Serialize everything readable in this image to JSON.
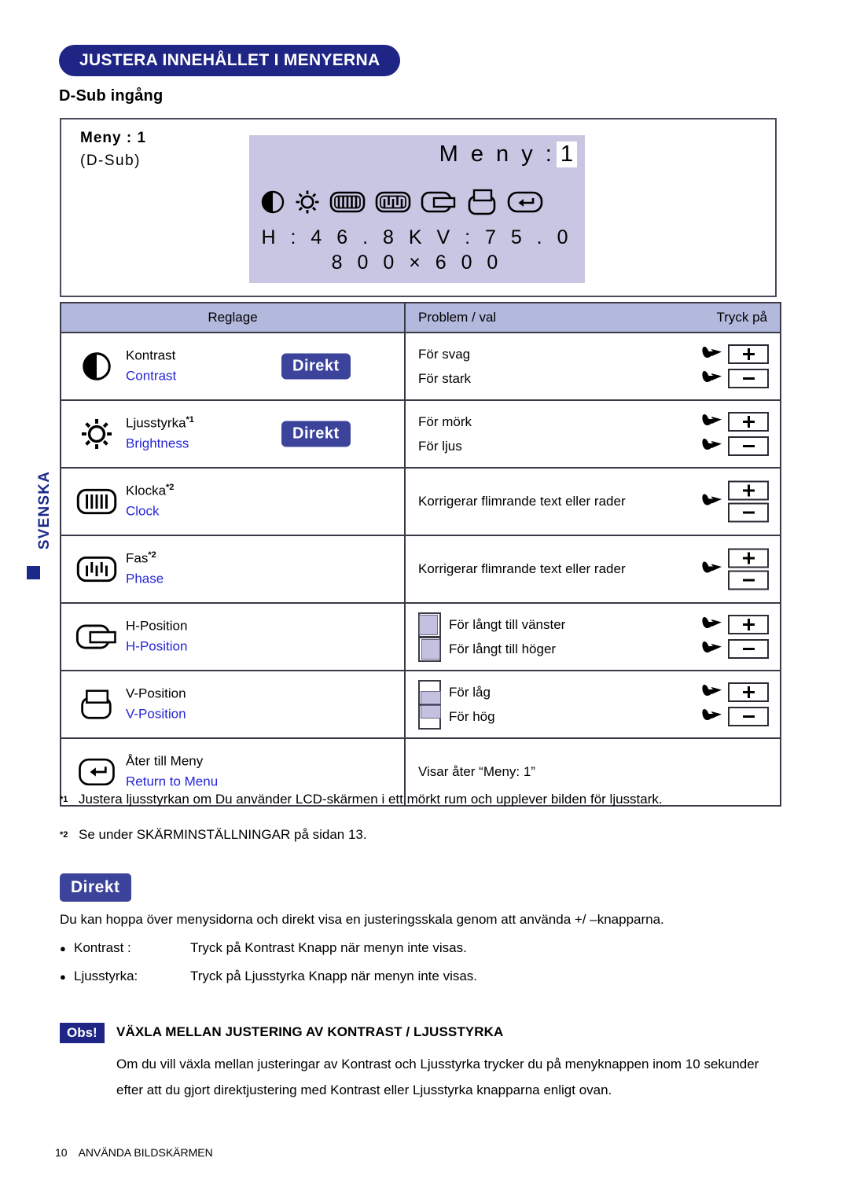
{
  "side_tab": {
    "language": "SVENSKA"
  },
  "header": {
    "title": "JUSTERA INNEHÅLLET I MENYERNA",
    "subtitle": "D-Sub ingång"
  },
  "osd_preview": {
    "left_title": "Meny : 1",
    "left_sub": "(D-Sub)",
    "menu_label": "M e n y :",
    "menu_number": "1",
    "frequency": "H : 4 6 . 8 K   V : 7 5 . 0",
    "resolution": "8 0 0  ×  6 0 0",
    "icons": [
      "contrast-icon",
      "brightness-icon",
      "clock-icon",
      "phase-icon",
      "h-position-icon",
      "v-position-icon",
      "return-icon"
    ]
  },
  "table": {
    "headers": {
      "reglage": "Reglage",
      "problem": "Problem / val",
      "tryck": "Tryck på"
    },
    "rows": [
      {
        "icon": "contrast-icon",
        "label_sv": "Kontrast",
        "label_en": "Contrast",
        "footnote": "",
        "direkt": "Direkt",
        "options": [
          {
            "text": "För svag",
            "button": "+"
          },
          {
            "text": "För stark",
            "button": "−"
          }
        ]
      },
      {
        "icon": "brightness-icon",
        "label_sv": "Ljusstyrka",
        "label_en": "Brightness",
        "footnote": "*1",
        "direkt": "Direkt",
        "options": [
          {
            "text": "För mörk",
            "button": "+"
          },
          {
            "text": "För ljus",
            "button": "−"
          }
        ]
      },
      {
        "icon": "clock-icon",
        "label_sv": "Klocka",
        "label_en": "Clock",
        "footnote": "*2",
        "direkt": "",
        "single_option": "Korrigerar flimrande text eller rader",
        "buttons": [
          "+",
          "−"
        ]
      },
      {
        "icon": "phase-icon",
        "label_sv": "Fas",
        "label_en": "Phase",
        "footnote": "*2",
        "direkt": "",
        "single_option": "Korrigerar flimrande text eller rader",
        "buttons": [
          "+",
          "−"
        ]
      },
      {
        "icon": "h-position-icon",
        "label_sv": "H-Position",
        "label_en": "H-Position",
        "footnote": "",
        "direkt": "",
        "options": [
          {
            "text": "För långt till vänster",
            "button": "+",
            "thumb": "content-left"
          },
          {
            "text": "För långt till höger",
            "button": "−",
            "thumb": "content-right"
          }
        ]
      },
      {
        "icon": "v-position-icon",
        "label_sv": "V-Position",
        "label_en": "V-Position",
        "footnote": "",
        "direkt": "",
        "options": [
          {
            "text": "För låg",
            "button": "+",
            "thumb": "content-bottom"
          },
          {
            "text": "För hög",
            "button": "−",
            "thumb": "content-top"
          }
        ]
      },
      {
        "icon": "return-icon",
        "label_sv": "Åter till Meny",
        "label_en": "Return to Menu",
        "footnote": "",
        "direkt": "",
        "single_option": "Visar åter “Meny: 1”",
        "buttons": []
      }
    ]
  },
  "footnotes": [
    {
      "mark": "*1",
      "text": "Justera ljusstyrkan om Du använder LCD-skärmen i ett mörkt rum och upplever bilden för ljusstark."
    },
    {
      "mark": "*2",
      "text": "Se under SKÄRMINSTÄLLNINGAR på sidan 13."
    }
  ],
  "direkt_section": {
    "badge": "Direkt",
    "paragraph": "Du kan hoppa över menysidorna och direkt visa en justeringsskala genom att använda +/ –knapparna.",
    "items": [
      {
        "key": "Kontrast :",
        "value": "Tryck på Kontrast Knapp när menyn inte visas."
      },
      {
        "key": "Ljusstyrka:",
        "value": "Tryck på Ljusstyrka Knapp när menyn inte visas."
      }
    ]
  },
  "note": {
    "badge": "Obs!",
    "title": "VÄXLA MELLAN JUSTERING AV KONTRAST / LJUSSTYRKA",
    "body": "Om du vill växla mellan justeringar av Kontrast och Ljusstyrka trycker du på menyknappen inom 10 sekunder efter att du gjort direktjustering med Kontrast eller Ljusstyrka knapparna enligt ovan."
  },
  "footer": {
    "page_number": "10",
    "section": "ANVÄNDA BILDSKÄRMEN"
  },
  "colors": {
    "brand_blue": "#1f2585",
    "badge_blue": "#3c439a",
    "osd_lavender": "#c9c6e3",
    "table_header": "#b3b8dd",
    "link_blue": "#2525d8"
  }
}
